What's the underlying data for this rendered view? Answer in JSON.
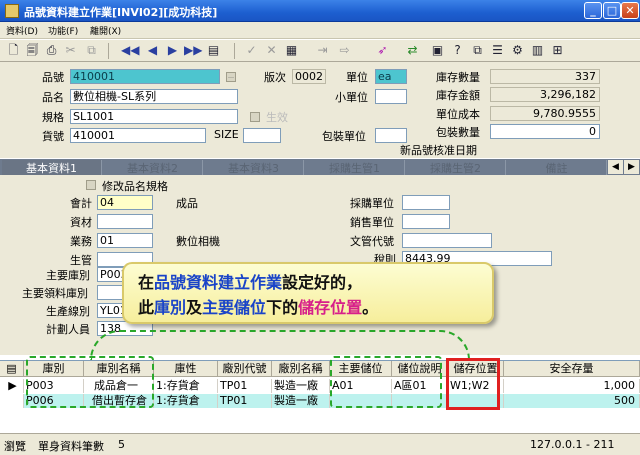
{
  "window": {
    "title": "品號資料建立作業[INVI02][成功科技]",
    "min": "_",
    "max": "□",
    "close": "✕"
  },
  "menu": [
    "資料(D)",
    "功能(F)",
    "離開(X)"
  ],
  "toolbar_icons": [
    "new-doc",
    "preview",
    "print",
    "clip",
    "copy",
    "first",
    "prev",
    "next",
    "last",
    "menu",
    "confirm",
    "cancel",
    "save",
    "find",
    "next-record",
    "edit",
    "swap",
    "chart",
    "question",
    "copy2",
    "list",
    "tools",
    "books",
    "help"
  ],
  "header": {
    "item_no_label": "品號",
    "item_no": "410001",
    "item_name_label": "品名",
    "item_name": "數位相機-SL系列",
    "spec_label": "規格",
    "spec": "SL1001",
    "cargo_no_label": "貨號",
    "cargo_no": "410001",
    "version_label": "版次",
    "version": "0002",
    "size_label": "SIZE",
    "size": "",
    "unit_label": "單位",
    "unit": "ea",
    "small_unit_label": "小單位",
    "small_unit": "",
    "pack_unit_label": "包裝單位",
    "pack_unit": "",
    "valid_label": "生效",
    "checkbox_text": "",
    "stock_qty_label": "庫存數量",
    "stock_qty": "337",
    "stock_amount_label": "庫存金額",
    "stock_amount": "3,296,182",
    "unit_cost_label": "單位成本",
    "unit_cost": "9,780.9555",
    "pack_qty_label": "包裝數量",
    "pack_qty": "0",
    "new_item_date_label": "新品號核准日期"
  },
  "tabs": [
    "基本資料1",
    "基本資料2",
    "基本資料3",
    "採購生管1",
    "採購生管2",
    "備註"
  ],
  "detail": {
    "modify_name_spec": "修改品名規格",
    "accounting_label": "會計",
    "accounting": "04",
    "accounting_desc": "成品",
    "material_label": "資材",
    "material": "",
    "business_label": "業務",
    "business": "01",
    "business_desc": "數位相機",
    "production_label": "生管",
    "production": "",
    "main_warehouse_label": "主要庫別",
    "main_warehouse": "P003",
    "main_pick_label": "主要領料庫別",
    "main_pick": "",
    "production_line_label": "生產線別",
    "production_line": "YL01",
    "planner_label": "計劃人員",
    "planner": "138",
    "purchase_unit_label": "採購單位",
    "purchase_unit": "",
    "sales_unit_label": "銷售單位",
    "sales_unit": "",
    "doc_code_label": "文管代號",
    "doc_code": "",
    "tax_rate_label": "稅則",
    "tax_rate": "8443.99"
  },
  "callout": {
    "line1_a": "在",
    "line1_b": "品號資料建立作業",
    "line1_c": "設定好的，",
    "line2_a": "此",
    "line2_b": "庫別",
    "line2_c": "及",
    "line2_d": "主要儲位",
    "line2_e": "下的",
    "line2_f": "儲存位置",
    "line2_g": "。"
  },
  "grid": {
    "columns": [
      "庫別",
      "庫別名稱",
      "庫性",
      "廠別代號",
      "廠別名稱",
      "主要儲位",
      "儲位說明",
      "儲存位置",
      "安全存量"
    ],
    "rows": [
      [
        "P003",
        "成品倉一",
        "1:存貨倉",
        "TP01",
        "製造一廠",
        "A01",
        "A區01",
        "W1;W2",
        "1,000"
      ],
      [
        "P006",
        "借出暫存倉",
        "1:存貨倉",
        "TP01",
        "製造一廠",
        "",
        "",
        "",
        "500"
      ]
    ]
  },
  "status": {
    "mode": "瀏覽",
    "record_label": "單身資料筆數",
    "record_count": "5",
    "server": "127.0.0.1 - 211"
  },
  "colors": {
    "title": "#1d5fd0",
    "highlight_field": "#4dc5cf",
    "dash": "#2aa82a",
    "red": "#e02020"
  }
}
